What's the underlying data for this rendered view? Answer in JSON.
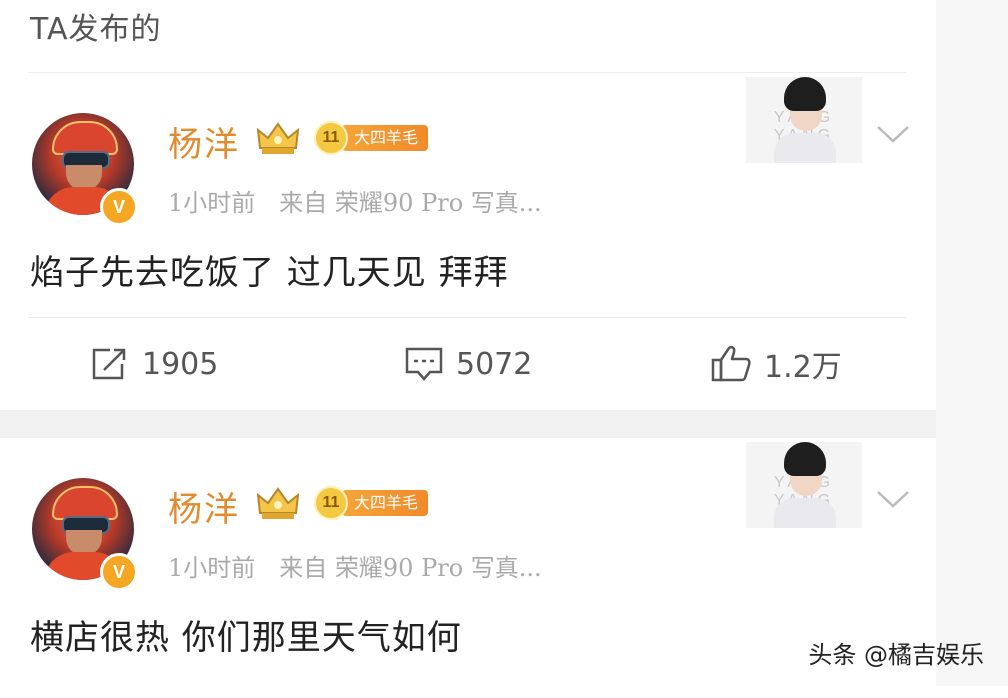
{
  "header": {
    "title": "TA发布的"
  },
  "posts": [
    {
      "username": "杨洋",
      "level": "11",
      "level_tag": "大四羊毛",
      "verified_mark": "V",
      "time": "1小时前",
      "source": "来自 荣耀90 Pro 写真...",
      "text": "焰子先去吃饭了 过几天见 拜拜",
      "thumb_watermark": "YANG YANG",
      "repost_count": "1905",
      "comment_count": "5072",
      "like_count": "1.2万"
    },
    {
      "username": "杨洋",
      "level": "11",
      "level_tag": "大四羊毛",
      "verified_mark": "V",
      "time": "1小时前",
      "source": "来自 荣耀90 Pro 写真...",
      "text": "横店很热 你们那里天气如何",
      "thumb_watermark": "YANG YANG"
    }
  ],
  "watermark": "头条 @橘吉娱乐",
  "colors": {
    "username": "#e38a2d",
    "level_tag": "#f08a2a",
    "verified": "#f5a623"
  },
  "icons": [
    "crown-icon",
    "chevron-down-icon",
    "repost-icon",
    "comment-icon",
    "like-icon"
  ]
}
